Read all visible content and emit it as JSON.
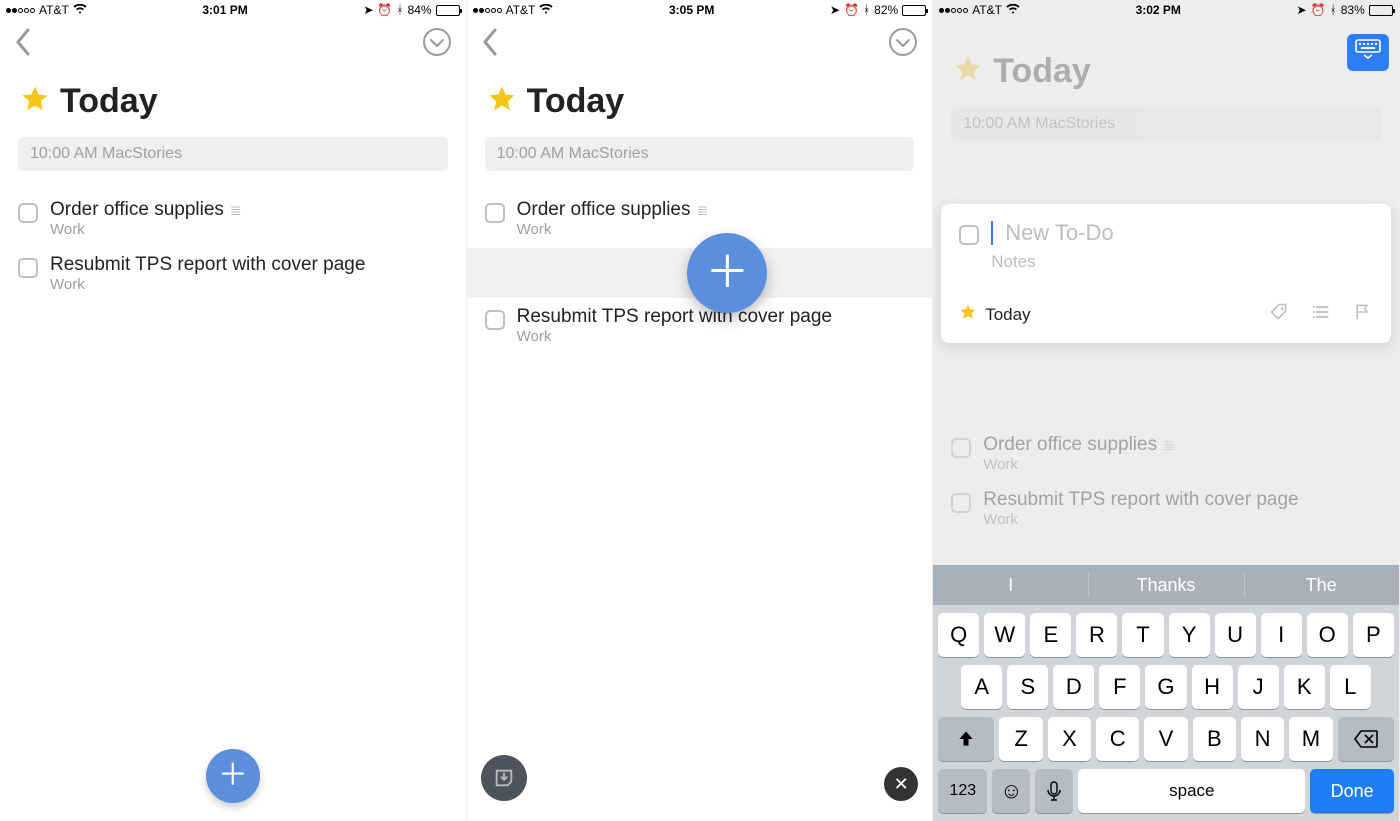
{
  "screens": [
    {
      "statusbar": {
        "carrier": "AT&T",
        "time": "3:01 PM",
        "battery_pct": "84%",
        "battery_fill": 84
      },
      "title": "Today",
      "event": "10:00 AM MacStories",
      "todos": [
        {
          "title": "Order office supplies",
          "sub": "Work",
          "has_checklist": true
        },
        {
          "title": "Resubmit TPS report with cover page",
          "sub": "Work",
          "has_checklist": false
        }
      ]
    },
    {
      "statusbar": {
        "carrier": "AT&T",
        "time": "3:05 PM",
        "battery_pct": "82%",
        "battery_fill": 82
      },
      "title": "Today",
      "event": "10:00 AM MacStories",
      "todos": [
        {
          "title": "Order office supplies",
          "sub": "Work",
          "has_checklist": true
        },
        {
          "title": "Resubmit TPS report with cover page",
          "sub": "Work",
          "has_checklist": false
        }
      ]
    },
    {
      "statusbar": {
        "carrier": "AT&T",
        "time": "3:02 PM",
        "battery_pct": "83%",
        "battery_fill": 83
      },
      "title": "Today",
      "event": "10:00 AM MacStories",
      "card": {
        "placeholder": "New To-Do",
        "notes_placeholder": "Notes",
        "list_label": "Today"
      },
      "todos": [
        {
          "title": "Order office supplies",
          "sub": "Work",
          "has_checklist": true
        },
        {
          "title": "Resubmit TPS report with cover page",
          "sub": "Work",
          "has_checklist": false
        }
      ],
      "keyboard": {
        "suggestions": [
          "I",
          "Thanks",
          "The"
        ],
        "rows": [
          [
            "Q",
            "W",
            "E",
            "R",
            "T",
            "Y",
            "U",
            "I",
            "O",
            "P"
          ],
          [
            "A",
            "S",
            "D",
            "F",
            "G",
            "H",
            "J",
            "K",
            "L"
          ],
          [
            "Z",
            "X",
            "C",
            "V",
            "B",
            "N",
            "M"
          ]
        ],
        "numbers_key": "123",
        "space_key": "space",
        "done_key": "Done"
      }
    }
  ]
}
